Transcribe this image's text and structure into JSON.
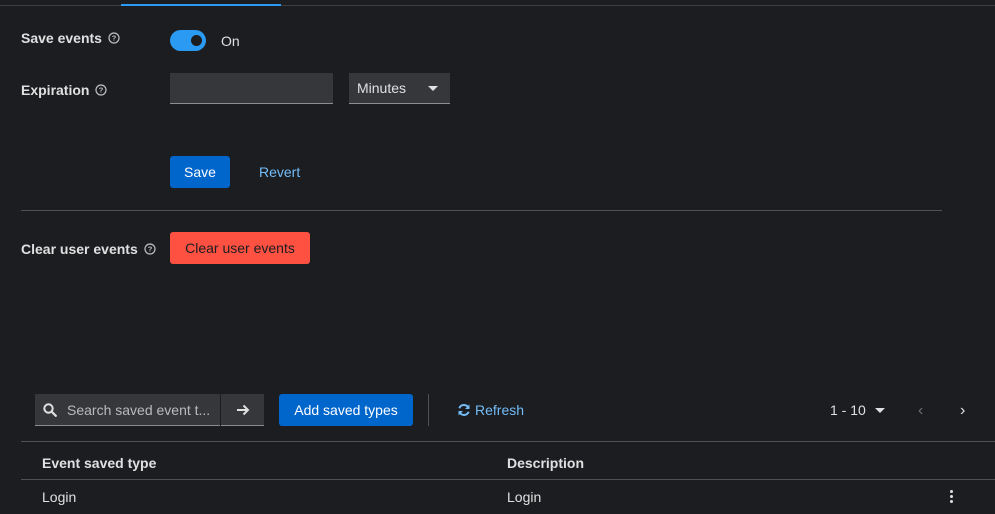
{
  "form": {
    "save_events": {
      "label": "Save events",
      "toggle_state": "On",
      "enabled": true
    },
    "expiration": {
      "label": "Expiration",
      "value": "",
      "unit": "Minutes"
    },
    "save_label": "Save",
    "revert_label": "Revert"
  },
  "clear": {
    "label": "Clear user events",
    "button_label": "Clear user events"
  },
  "toolbar": {
    "search_placeholder": "Search saved event t...",
    "add_label": "Add saved types",
    "refresh_label": "Refresh",
    "pagination": "1 - 10"
  },
  "table": {
    "columns": [
      "Event saved type",
      "Description"
    ],
    "rows": [
      {
        "type": "Login",
        "description": "Login"
      }
    ]
  },
  "colors": {
    "accent": "#2b9af3",
    "primary": "#0066cc",
    "danger": "#fe5142",
    "background": "#1b1d21"
  }
}
